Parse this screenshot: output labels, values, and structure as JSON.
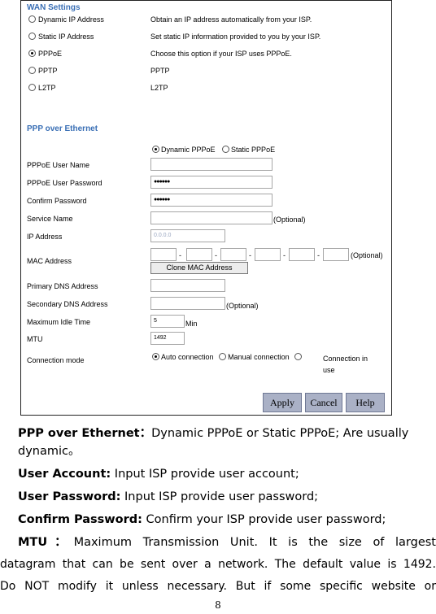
{
  "wan": {
    "title": "WAN Settings",
    "options": [
      {
        "label": "Dynamic IP Address",
        "desc": "Obtain an IP address automatically from your ISP.",
        "selected": false
      },
      {
        "label": "Static IP Address",
        "desc": "Set static IP information provided to you by your ISP.",
        "selected": false
      },
      {
        "label": "PPPoE",
        "desc": "Choose this option if your ISP uses PPPoE.",
        "selected": true
      },
      {
        "label": "PPTP",
        "desc": "PPTP",
        "selected": false
      },
      {
        "label": "L2TP",
        "desc": "L2TP",
        "selected": false
      }
    ]
  },
  "ppp": {
    "title": "PPP over Ethernet",
    "mode_dynamic": "Dynamic PPPoE",
    "mode_static": "Static PPPoE",
    "labels": {
      "user_name": "PPPoE User Name",
      "user_password": "PPPoE User Password",
      "confirm_password": "Confirm Password",
      "service_name": "Service Name",
      "ip_address": "IP Address",
      "mac_address": "MAC Address",
      "primary_dns": "Primary DNS Address",
      "secondary_dns": "Secondary DNS Address",
      "max_idle": "Maximum Idle Time",
      "mtu": "MTU",
      "connection_mode": "Connection mode"
    },
    "values": {
      "user_password": "●●●●●●",
      "confirm_password": "●●●●●●",
      "ip_address": "0.0.0.0",
      "max_idle": "5",
      "mtu": "1492"
    },
    "optional": "(Optional)",
    "mac_sep": "-",
    "min_label": "Min",
    "clone_mac": "Clone MAC Address",
    "conn_auto": "Auto connection",
    "conn_manual": "Manual connection",
    "conn_in_use": "Connection in use"
  },
  "buttons": {
    "apply": "Apply",
    "cancel": "Cancel",
    "help": "Help"
  },
  "doc": {
    "l1_bold": "PPP over Ethernet：",
    "l1_rest": "Dynamic PPPoE or Static PPPoE; Are usually",
    "l2": "dynamic。",
    "l3_bold": "User Account:",
    "l3_rest": " Input ISP provide user account;",
    "l4_bold": "User Password:",
    "l4_rest": " Input ISP provide user password;",
    "l5_bold": "Confirm Password:",
    "l5_rest": " Confirm your ISP provide user password;",
    "l6_bold": "MTU：",
    "l6_rest": "Maximum Transmission Unit. It is the size of largest",
    "l7": "datagram that can be sent over a network. The default value is 1492.",
    "l8": "Do NOT modify it unless necessary. But if some specific website or",
    "page_number": "8"
  }
}
